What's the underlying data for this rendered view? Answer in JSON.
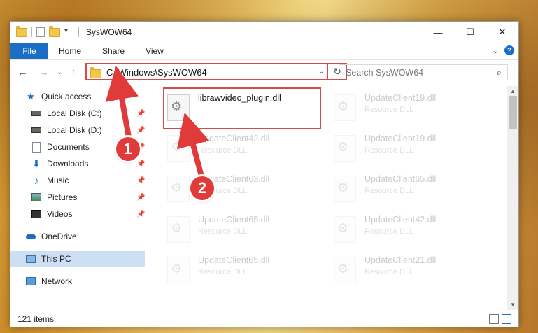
{
  "window": {
    "title": "SysWOW64"
  },
  "titlebar": {
    "minimize": "—",
    "maximize": "☐",
    "close": "✕"
  },
  "ribbon": {
    "tabs": [
      "File",
      "Home",
      "Share",
      "View"
    ],
    "collapse": "⌄",
    "help": "?"
  },
  "nav": {
    "back": "←",
    "forward": "→",
    "recent": "⌄",
    "up": "↑",
    "address": "C:\\Windows\\SysWOW64",
    "dropdown": "⌄",
    "refresh": "↻",
    "search_placeholder": "Search SysWOW64"
  },
  "sidebar": {
    "items": [
      {
        "label": "Quick access",
        "icon": "star-icon"
      },
      {
        "label": "Local Disk (C:)",
        "icon": "drive-icon",
        "pinned": true
      },
      {
        "label": "Local Disk (D:)",
        "icon": "drive-icon",
        "pinned": true
      },
      {
        "label": "Documents",
        "icon": "documents-icon",
        "pinned": true
      },
      {
        "label": "Downloads",
        "icon": "downloads-icon",
        "pinned": true
      },
      {
        "label": "Music",
        "icon": "music-icon",
        "pinned": true
      },
      {
        "label": "Pictures",
        "icon": "pictures-icon",
        "pinned": true
      },
      {
        "label": "Videos",
        "icon": "videos-icon",
        "pinned": true
      },
      {
        "label": "OneDrive",
        "icon": "onedrive-icon"
      },
      {
        "label": "This PC",
        "icon": "computer-icon",
        "selected": true
      },
      {
        "label": "Network",
        "icon": "network-icon"
      }
    ],
    "pin_glyph": "📌"
  },
  "files": [
    {
      "name": "librawvideo_plugin.dll",
      "sub": ""
    },
    {
      "name": "UpdateClient19.dll",
      "sub": "Resource DLL"
    },
    {
      "name": "UpdateClient42.dll",
      "sub": "Resource DLL"
    },
    {
      "name": "UpdateClient19.dll",
      "sub": "Resource DLL"
    },
    {
      "name": "UpdateClient63.dll",
      "sub": "Resource DLL"
    },
    {
      "name": "UpdateClient65.dll",
      "sub": "Resource DLL"
    },
    {
      "name": "UpdateClient65.dll",
      "sub": "Resource DLL"
    },
    {
      "name": "UpdateClient42.dll",
      "sub": "Resource DLL"
    },
    {
      "name": "UpdateClient65.dll",
      "sub": "Resource DLL"
    },
    {
      "name": "UpdateClient21.dll",
      "sub": "Resource DLL"
    }
  ],
  "status": {
    "count": "121 items"
  },
  "callouts": [
    "1",
    "2"
  ],
  "colors": {
    "accent": "#1a6fc4",
    "highlight": "#d64a4a",
    "callout": "#e03a3a",
    "selected": "#ccdff5"
  }
}
